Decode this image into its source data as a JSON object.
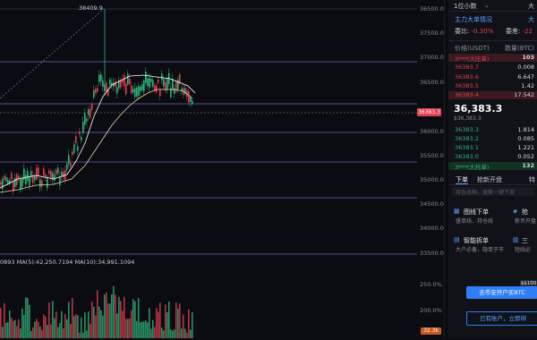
{
  "chart": {
    "peak_label": "38409.9",
    "y_axis_ticks": [
      "36500.0",
      "37500.0",
      "37000.0",
      "36500.0",
      "36000.0",
      "35500.0",
      "35000.0",
      "34500.0",
      "34000.0",
      "33500.0",
      "33000.0",
      "32500.0",
      "250.0%",
      "200.0%",
      "150.0%",
      "100.0%",
      "50.0%"
    ],
    "current_price_badge": "36383.3",
    "ma_legend": "0893 MA(5):42,250.7194 MA(10):34,991.1094",
    "volume_badge": "32.3k"
  },
  "side": {
    "top_bar": {
      "left": "1位小数",
      "right": "大"
    },
    "main_info_label": "主力大单情况",
    "main_info_right": "大",
    "weibi_label": "委比:",
    "weibi_value": "-0.30%",
    "weicha_label": "委差:",
    "weicha_value": "-22",
    "col_price": "价格(USDT)",
    "col_qty": "数量(BTC)",
    "ask_big_label": "3***(大压单)",
    "ask_big_qty": "103",
    "asks": [
      {
        "price": "36383.7",
        "qty": "0.008"
      },
      {
        "price": "36383.6",
        "qty": "6.647"
      },
      {
        "price": "36383.5",
        "qty": "1.42"
      },
      {
        "price": "36383.4",
        "qty": "17.542"
      }
    ],
    "last_price": "36,383.3",
    "last_price_sub": "$36,383.3",
    "bids": [
      {
        "price": "36383.3",
        "qty": "1.814"
      },
      {
        "price": "36383.2",
        "qty": "0.085"
      },
      {
        "price": "36383.1",
        "qty": "1.221"
      },
      {
        "price": "36383.0",
        "qty": "0.052"
      }
    ],
    "bid_big_label": "3***(大托单)",
    "bid_big_qty": "132",
    "tabs": [
      "下单",
      "抢新开盘",
      "特"
    ],
    "search_placeholder": "持仓品种，搜索一键下单",
    "cards": [
      {
        "title": "图线下单",
        "desc": "盛单线、持仓线"
      },
      {
        "title": "抢",
        "desc": "新币开盘"
      },
      {
        "title": "智能拆单",
        "desc": "大户必备，隐单于市"
      },
      {
        "title": "三",
        "desc": "短线必"
      }
    ],
    "badge_100": "$$100",
    "buy_button": "去币安开户买BTC",
    "login_button": "已有账户，立即绑"
  }
}
